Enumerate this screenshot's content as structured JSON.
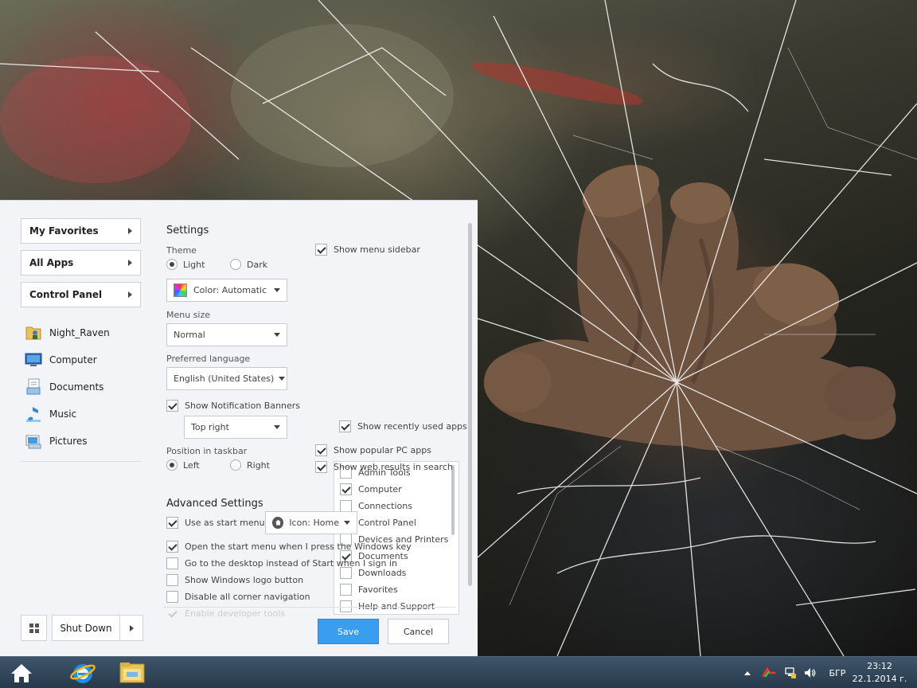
{
  "sidebar": {
    "favorites_label": "My Favorites",
    "all_apps_label": "All Apps",
    "control_panel_label": "Control Panel",
    "places": [
      {
        "label": "Night_Raven",
        "icon": "user-folder-icon"
      },
      {
        "label": "Computer",
        "icon": "computer-icon"
      },
      {
        "label": "Documents",
        "icon": "documents-icon"
      },
      {
        "label": "Music",
        "icon": "music-icon"
      },
      {
        "label": "Pictures",
        "icon": "pictures-icon"
      }
    ],
    "shutdown_label": "Shut Down"
  },
  "settings": {
    "title": "Settings",
    "theme_label": "Theme",
    "theme_light": "Light",
    "theme_dark": "Dark",
    "theme_selected": "Light",
    "color_value": "Color: Automatic",
    "menu_size_label": "Menu size",
    "menu_size_value": "Normal",
    "language_label": "Preferred language",
    "language_value": "English (United States)",
    "notification_label": "Show Notification Banners",
    "notification_checked": true,
    "notification_position_value": "Top right",
    "taskbar_position_label": "Position in taskbar",
    "taskbar_left": "Left",
    "taskbar_right": "Right",
    "taskbar_selected": "Left",
    "show_sidebar_label": "Show menu sidebar",
    "show_sidebar_checked": true,
    "sidebar_items": [
      {
        "label": "Admin Tools",
        "checked": false
      },
      {
        "label": "Computer",
        "checked": true
      },
      {
        "label": "Connections",
        "checked": false
      },
      {
        "label": "Control Panel",
        "checked": false
      },
      {
        "label": "Devices and Printers",
        "checked": false
      },
      {
        "label": "Documents",
        "checked": true
      },
      {
        "label": "Downloads",
        "checked": false
      },
      {
        "label": "Favorites",
        "checked": false
      },
      {
        "label": "Help and Support",
        "checked": false
      }
    ],
    "recent_apps_label": "Show recently used apps",
    "recent_apps_checked": true,
    "popular_apps_label": "Show popular PC apps",
    "popular_apps_checked": true,
    "web_results_label": "Show web results in search",
    "web_results_checked": true
  },
  "advanced": {
    "title": "Advanced Settings",
    "use_start_label": "Use as start menu",
    "use_start_checked": true,
    "icon_value": "Icon: Home",
    "open_windows_key_label": "Open the start menu when I press the Windows key",
    "open_windows_key_checked": true,
    "desktop_signin_label": "Go to the desktop instead of Start when I sign in",
    "desktop_signin_checked": false,
    "logo_button_label": "Show Windows logo button",
    "logo_button_checked": false,
    "corner_nav_label": "Disable all corner navigation",
    "corner_nav_checked": false,
    "dev_tools_label": "Enable developer tools",
    "dev_tools_checked": true
  },
  "buttons": {
    "save": "Save",
    "cancel": "Cancel"
  },
  "taskbar": {
    "language": "БГР",
    "time": "23:12",
    "date": "22.1.2014 г."
  },
  "colors": {
    "accent": "#3a9ef0",
    "menu_background": "#f2f4f7"
  }
}
